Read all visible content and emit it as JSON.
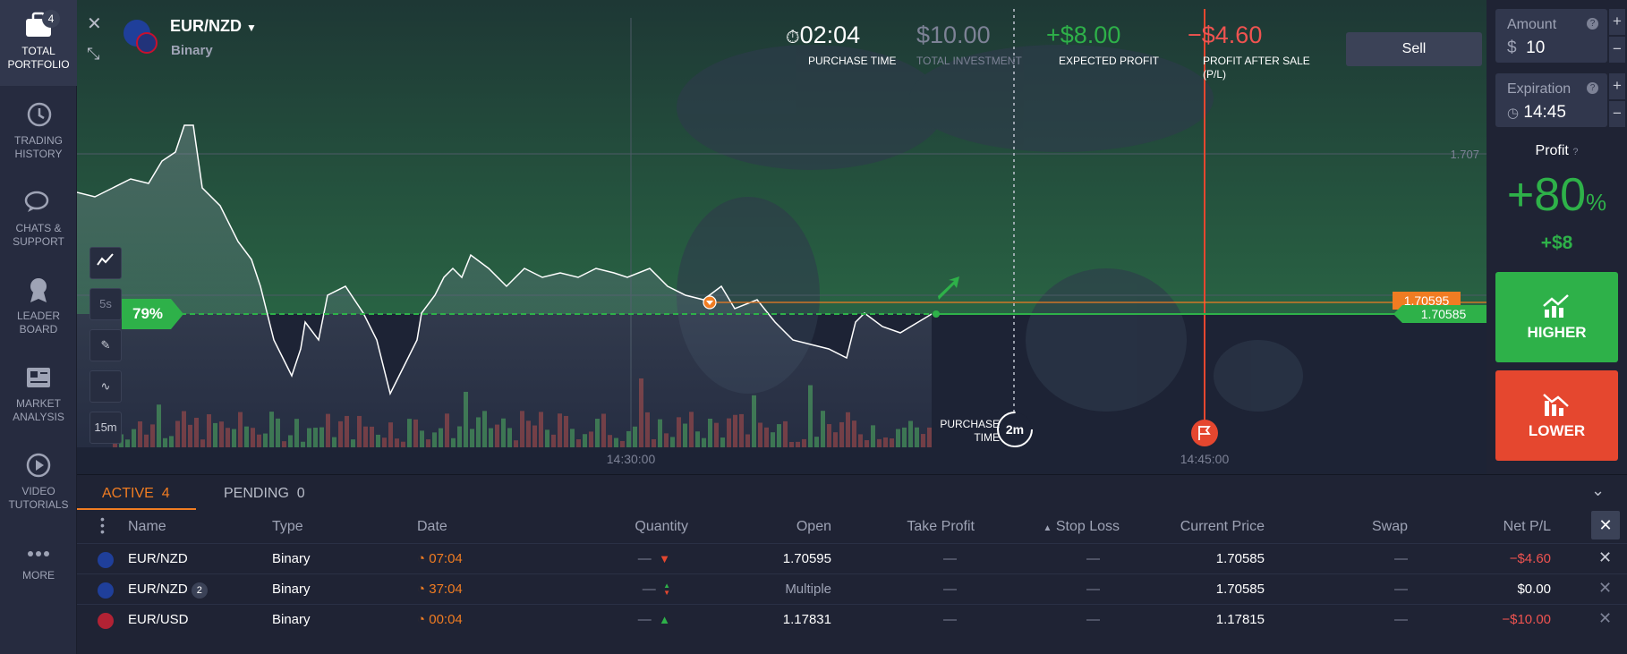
{
  "sidebar": {
    "items": [
      {
        "label": "TOTAL PORTFOLIO",
        "icon": "briefcase-icon",
        "badge": "4"
      },
      {
        "label": "TRADING HISTORY",
        "icon": "history-icon"
      },
      {
        "label": "CHATS & SUPPORT",
        "icon": "chat-icon"
      },
      {
        "label": "LEADER BOARD",
        "icon": "award-icon"
      },
      {
        "label": "MARKET ANALYSIS",
        "icon": "newspaper-icon"
      },
      {
        "label": "VIDEO TUTORIALS",
        "icon": "play-icon"
      },
      {
        "label": "MORE",
        "icon": "more-icon"
      }
    ]
  },
  "asset": {
    "name": "EUR/NZD",
    "type": "Binary"
  },
  "header": {
    "purchase_time": {
      "value": "02:04",
      "label": "PURCHASE TIME"
    },
    "total_investment": {
      "value": "$10.00",
      "label": "TOTAL INVESTMENT"
    },
    "expected_profit": {
      "value": "+$8.00",
      "label": "EXPECTED PROFIT"
    },
    "profit_after_sale": {
      "value": "−$4.60",
      "label": "PROFIT AFTER SALE (P/L)"
    },
    "sell_label": "Sell"
  },
  "chart": {
    "payout_percent": "79%",
    "price_label_1": "1.707",
    "price_label_open": "1.70595",
    "price_label_current": "1.70585",
    "time_label_1": "14:30:00",
    "time_label_2": "14:45:00",
    "purchase_time_label": "PURCHASE TIME",
    "purchase_timer": "2m",
    "timeframe_5s": "5s",
    "timeframe_15m": "15m"
  },
  "right_panel": {
    "amount_label": "Amount",
    "amount_currency": "$",
    "amount_value": "10",
    "expiration_label": "Expiration",
    "expiration_value": "14:45",
    "profit_label": "Profit",
    "profit_percent": "+80",
    "profit_percent_sign": "%",
    "profit_amount": "+$8",
    "higher_label": "HIGHER",
    "lower_label": "LOWER"
  },
  "bottom": {
    "tabs": [
      {
        "label": "ACTIVE",
        "count": "4"
      },
      {
        "label": "PENDING",
        "count": "0"
      }
    ],
    "columns": [
      "Name",
      "Type",
      "Date",
      "Quantity",
      "Open",
      "Take Profit",
      "Stop Loss",
      "Current Price",
      "Swap",
      "Net P/L"
    ],
    "rows": [
      {
        "name": "EUR/NZD",
        "type": "Binary",
        "date": "07:04",
        "quantity": "—",
        "direction": "down",
        "open": "1.70595",
        "take_profit": "—",
        "stop_loss": "—",
        "current": "1.70585",
        "swap": "—",
        "net": "−$4.60",
        "net_color": "#ef5350"
      },
      {
        "name": "EUR/NZD",
        "badge": "2",
        "type": "Binary",
        "date": "37:04",
        "quantity": "—",
        "direction": "both",
        "open": "Multiple",
        "take_profit": "—",
        "stop_loss": "—",
        "current": "1.70585",
        "swap": "—",
        "net": "$0.00",
        "net_color": "#ffffff"
      },
      {
        "name": "EUR/USD",
        "type": "Binary",
        "date": "00:04",
        "quantity": "—",
        "direction": "up",
        "open": "1.17831",
        "take_profit": "—",
        "stop_loss": "—",
        "current": "1.17815",
        "swap": "—",
        "net": "−$10.00",
        "net_color": "#ef5350"
      }
    ]
  },
  "colors": {
    "green": "#2eb149",
    "red": "#e5472f",
    "orange": "#f07c22",
    "bg": "#1f2334"
  }
}
